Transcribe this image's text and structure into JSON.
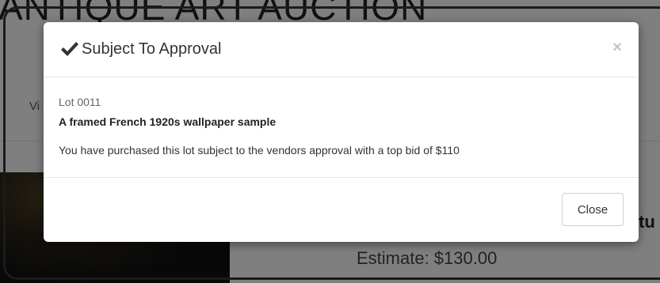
{
  "background": {
    "site_title": "ANTIQUE ART AUCTION",
    "tab_fragment": "Vi",
    "side_text_fragment": "tu",
    "estimate": "Estimate: $130.00"
  },
  "modal": {
    "icon": "check-icon",
    "title": "Subject To Approval",
    "close_glyph": "×",
    "lot_number": "Lot 0011",
    "lot_title": "A framed French 1920s wallpaper sample",
    "message": "You have purchased this lot subject to the vendors approval with a top bid of $110",
    "close_button_label": "Close"
  },
  "colors": {
    "backdrop": "#000000",
    "modal_background": "#ffffff",
    "title_text": "#333333",
    "close_x": "#c4c4c4"
  }
}
